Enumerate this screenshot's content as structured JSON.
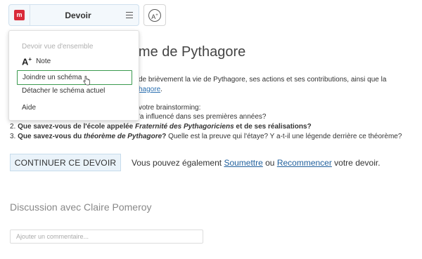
{
  "toolbar": {
    "title": "Devoir",
    "logo_text": "m",
    "font_button_label": "A",
    "font_button_sup": "+"
  },
  "page": {
    "title": "orème de Pythagore",
    "intro_line_1": "de brièvement la vie de Pythagore, ses actions et ses contributions, ainsi que la",
    "intro_link": "hagore",
    "intro_link_end": ".",
    "brainstorm_line": "votre brainstorming:",
    "q1_tail": "'a influencé dans ses premières années?",
    "q2": {
      "num": "2.",
      "bold_a": "Que savez-vous de l'école appelée ",
      "italic": "Fraternité des Pythagoriciens",
      "bold_b": " et de ses réalisations?"
    },
    "q3": {
      "num": "3.",
      "bold_a": "Que savez-vous du ",
      "italic": "théorème de Pythagore",
      "bold_b": "?",
      "rest": " Quelle est la preuve qui l'étaye? Y a-t-il une légende derrière ce théorème?"
    }
  },
  "actions": {
    "continue_label": "CONTINUER CE DEVOIR",
    "line_prefix": "Vous pouvez également ",
    "submit_link": "Soumettre",
    "or": " ou ",
    "restart_link": "Recommencer",
    "line_suffix": " votre devoir."
  },
  "discussion": {
    "title": "Discussion avec Claire Pomeroy",
    "comment_placeholder": "Ajouter un commentaire..."
  },
  "menu": {
    "header": "Devoir vue d'ensemble",
    "note_icon": "A",
    "note_icon_sup": "+",
    "items": [
      "Note",
      "Joindre un schéma",
      "Détacher le schéma actuel",
      "Aide"
    ]
  },
  "colors": {
    "accent": "#3a9a4e",
    "logo": "#d92b3a",
    "link": "#1f5f9c"
  }
}
